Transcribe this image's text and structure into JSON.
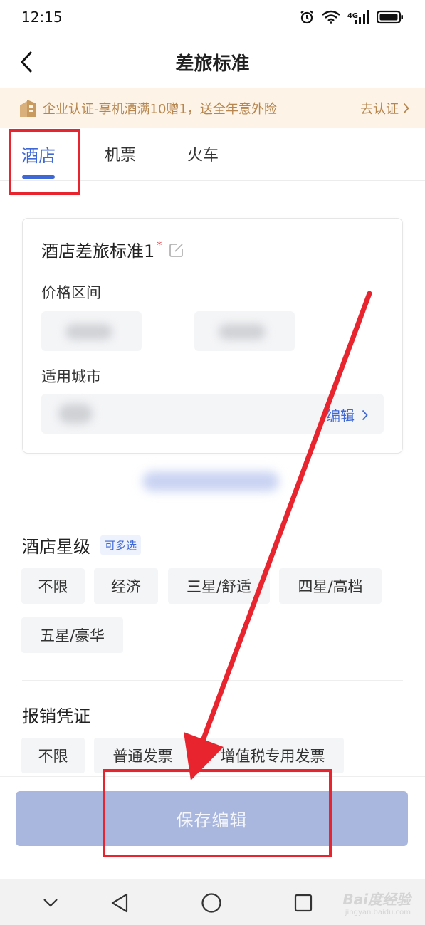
{
  "status": {
    "time": "12:15",
    "network_label": "4G",
    "icons": [
      "alarm-icon",
      "wifi-icon",
      "signal-icon",
      "battery-icon"
    ]
  },
  "header": {
    "title": "差旅标准",
    "back_icon": "chevron-left-icon"
  },
  "promo": {
    "text": "企业认证-享机酒满10赠1，送全年意外险",
    "link_label": "去认证",
    "color": "#b7864f"
  },
  "tabs": [
    {
      "label": "酒店",
      "active": true
    },
    {
      "label": "机票",
      "active": false
    },
    {
      "label": "火车",
      "active": false
    }
  ],
  "hotel_standard": {
    "title": "酒店差旅标准1",
    "required_mark": "*",
    "price_label": "价格区间",
    "city_label": "适用城市",
    "city_edit_label": "编辑"
  },
  "star_level": {
    "title": "酒店星级",
    "multi_tag": "可多选",
    "options": [
      "不限",
      "经济",
      "三星/舒适",
      "四星/高档",
      "五星/豪华"
    ]
  },
  "reimbursement": {
    "title": "报销凭证",
    "options": [
      "不限",
      "普通发票",
      "增值税专用发票"
    ]
  },
  "footer": {
    "save_label": "保存编辑"
  },
  "watermark": {
    "main": "Bai度经验",
    "sub": "jingyan.baidu.com"
  },
  "colors": {
    "accent": "#3f68d4",
    "annotation": "#e8252f",
    "save_button": "#a9b6dd"
  }
}
